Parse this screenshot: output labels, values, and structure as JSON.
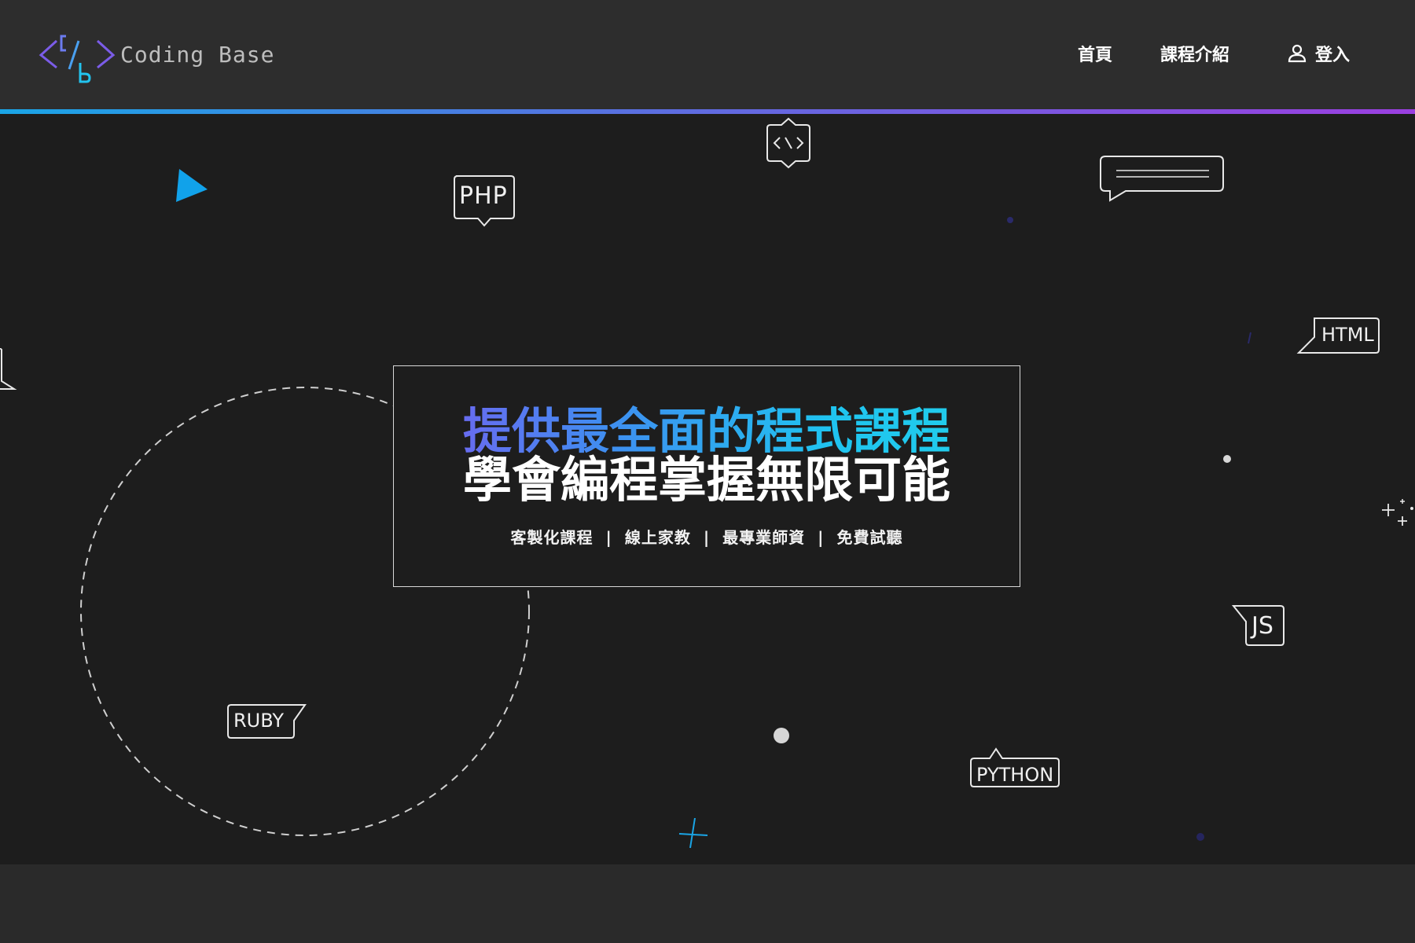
{
  "header": {
    "brand": "Coding Base",
    "nav": {
      "home": "首頁",
      "courses": "課程介紹",
      "login": "登入"
    }
  },
  "hero": {
    "headline_1": "提供最全面的程式課程",
    "headline_2": "學會編程掌握無限可能",
    "features": [
      "客製化課程",
      "線上家教",
      "最專業師資",
      "免費試聽"
    ],
    "separator": "|"
  },
  "tags": {
    "php": "PHP",
    "html": "HTML",
    "js": "JS",
    "ruby": "RUBY",
    "python": "PYTHON"
  },
  "colors": {
    "accent_blue": "#1aa5e6",
    "accent_purple": "#9b3fe0",
    "hero_bg": "#1d1d1d",
    "header_bg": "#2d2d2d"
  }
}
